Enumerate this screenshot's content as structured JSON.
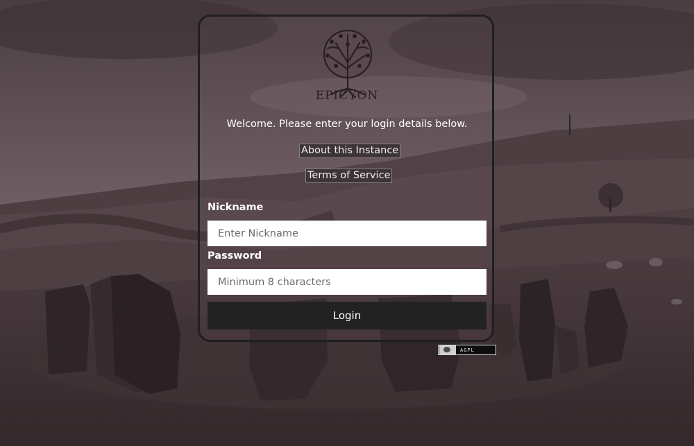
{
  "branding": {
    "logo_text": "EPICYON"
  },
  "welcome_text": "Welcome. Please enter your login details below.",
  "links": {
    "about": "About this Instance",
    "terms": "Terms of Service"
  },
  "form": {
    "nickname_label": "Nickname",
    "nickname_placeholder": "Enter Nickname",
    "password_label": "Password",
    "password_placeholder": "Minimum 8 characters",
    "login_label": "Login"
  },
  "footer": {
    "license_badge": "AGPL"
  },
  "colors": {
    "background_tint": "#3a2d30",
    "button_dark": "#222222",
    "input_bg": "#ffffff",
    "text_light": "#ffffff"
  }
}
